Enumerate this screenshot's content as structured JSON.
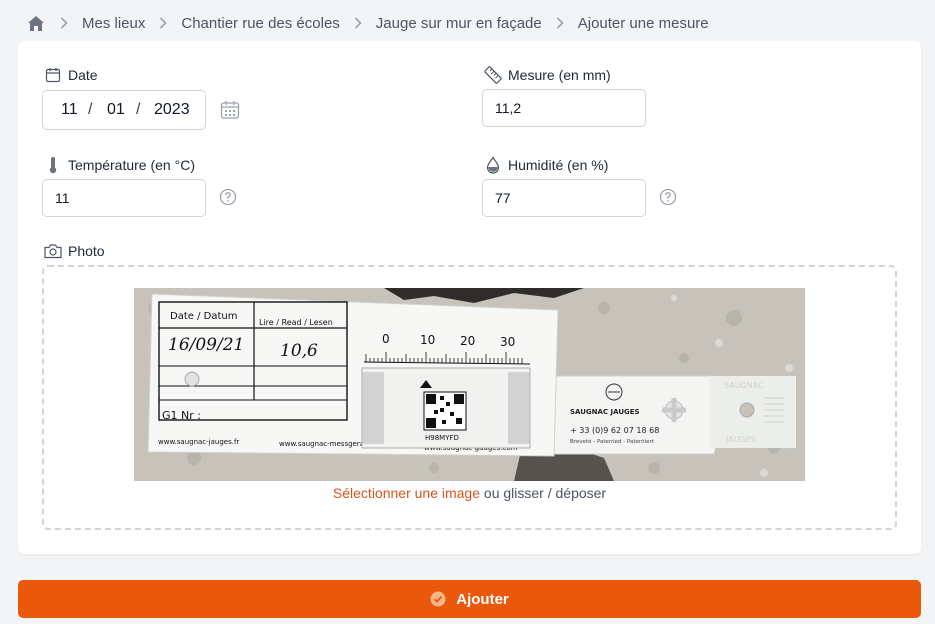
{
  "breadcrumb": {
    "home_icon": "home-icon",
    "items": [
      "Mes lieux",
      "Chantier rue des écoles",
      "Jauge sur mur en façade",
      "Ajouter une mesure"
    ]
  },
  "form": {
    "date": {
      "label": "Date",
      "icon": "calendar-icon",
      "day": "11",
      "month": "01",
      "year": "2023",
      "separator": "/"
    },
    "measure": {
      "label": "Mesure (en mm)",
      "icon": "ruler-icon",
      "value": "11,2"
    },
    "temperature": {
      "label": "Température (en °C)",
      "icon": "thermometer-icon",
      "value": "11"
    },
    "humidity": {
      "label": "Humidité (en %)",
      "icon": "droplet-icon",
      "value": "77"
    },
    "photo": {
      "label": "Photo",
      "icon": "camera-icon",
      "select_link": "Sélectionner une image",
      "drop_text": " ou glisser / déposer",
      "image": {
        "card_header_left": "Date / Datum",
        "card_header_right": "Lire / Read / Lesen",
        "handwritten_date": "16/09/21",
        "handwritten_value": "10,6",
        "serial": "G1  Nr :",
        "scale_labels": [
          "0",
          "10",
          "20",
          "30"
        ],
        "qr_code_text": "H98MYFD",
        "footer_url1": "www.saugnac-jauges.fr",
        "footer_url2": "www.saugnac-messgeraete.de",
        "footer_url3": "www.saugnac-gauges.com",
        "brand": "SAUGNAC JAUGES",
        "phone": "+ 33 (0)9 62 07 18 68",
        "patent": "Breveté - Patented - Patentiert",
        "side_text_top": "SAUGNAC",
        "side_text_bottom": "JAUGES"
      }
    }
  },
  "submit": {
    "label": "Ajouter",
    "icon": "check-circle-icon"
  },
  "colors": {
    "accent": "#ea580c",
    "link": "#d9541e",
    "background": "#f3f4f6"
  }
}
